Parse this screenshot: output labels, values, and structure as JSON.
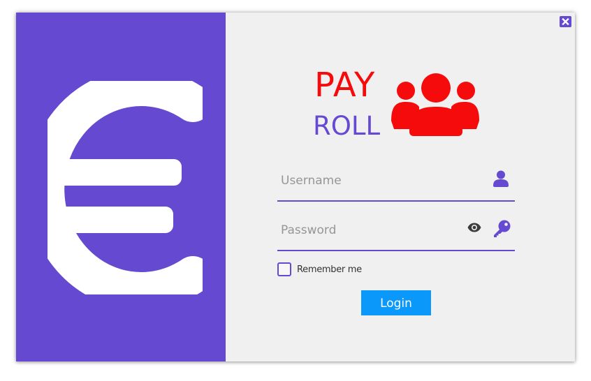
{
  "window": {
    "close_icon": "close-icon"
  },
  "left_panel": {
    "background": "#6649d1",
    "icon": "euro-icon"
  },
  "logo": {
    "line1": "PAY",
    "line2": "ROLL",
    "line1_color": "#f50b0b",
    "line2_color": "#6649d1",
    "icon": "users-group-icon"
  },
  "form": {
    "username": {
      "value": "",
      "placeholder": "Username",
      "icon": "user-icon"
    },
    "password": {
      "value": "",
      "placeholder": "Password",
      "show_icon": "eye-icon",
      "icon": "key-icon"
    },
    "remember": {
      "label": "Remember me",
      "checked": false
    },
    "login_label": "Login",
    "login_color": "#0a99fa"
  }
}
